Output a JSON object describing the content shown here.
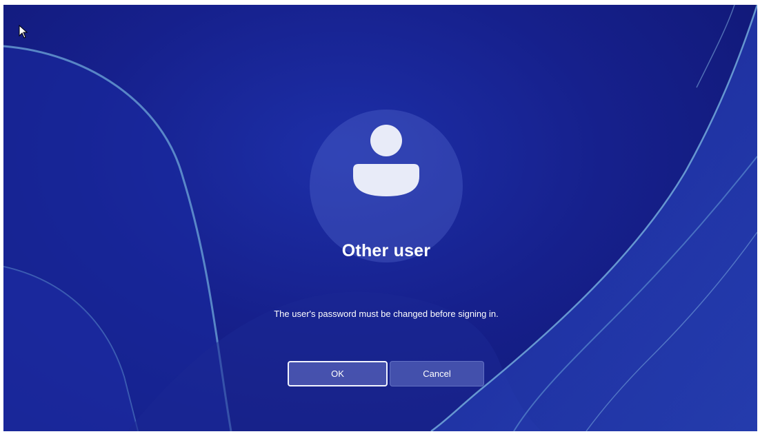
{
  "lockscreen": {
    "user_name": "Other user",
    "message": "The user's password must be changed before signing in."
  },
  "buttons": {
    "ok_label": "OK",
    "cancel_label": "Cancel"
  },
  "icons": {
    "avatar": "user-silhouette-icon",
    "cursor": "mouse-pointer-icon"
  },
  "colors": {
    "background": "#16208c",
    "text": "#ffffff",
    "avatar_circle": "#3a4bb8",
    "ribbon": "#6fa8d8"
  }
}
